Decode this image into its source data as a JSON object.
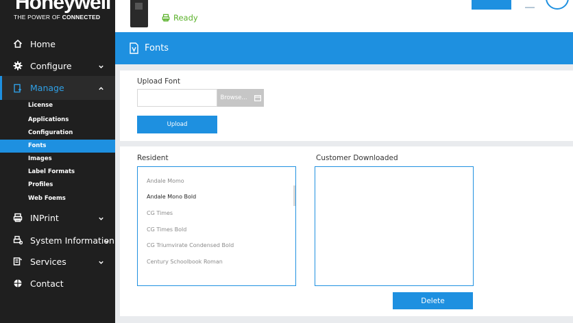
{
  "brand": {
    "name": "Honeywell",
    "tagline_prefix": "THE POWER OF ",
    "tagline_bold": "CONNECTED"
  },
  "header": {
    "status": "Ready",
    "status_color": "#5bb22b"
  },
  "sidebar": {
    "items": [
      {
        "label": "Home",
        "icon": "home-icon"
      },
      {
        "label": "Configure",
        "icon": "gear-icon"
      },
      {
        "label": "Manage",
        "icon": "document-icon"
      },
      {
        "label": "INPrint",
        "icon": "printer-icon"
      },
      {
        "label": "System Information",
        "icon": "printer-info-icon"
      },
      {
        "label": "Services",
        "icon": "services-icon"
      },
      {
        "label": "Contact",
        "icon": "globe-icon"
      }
    ],
    "manage_sub": [
      "License",
      "Applications",
      "Configuration",
      "Fonts",
      "Images",
      "Label Formats",
      "Profiles",
      "Web Foems"
    ],
    "active_sub": "Fonts"
  },
  "page": {
    "title": "Fonts"
  },
  "upload": {
    "label": "Upload Font",
    "file_value": "",
    "browse_label": "Browse...",
    "upload_label": "Upload"
  },
  "fonts": {
    "resident_label": "Resident",
    "customer_label": "Customer Downloaded",
    "resident_list": [
      "Andale Momo",
      "Andale Mono Bold",
      "CG Times",
      "CG Times Bold",
      "CG Triumvirate Condensed Bold",
      "Century Schoolbook Roman"
    ],
    "selected_resident": "Andale Mono Bold",
    "customer_list": [],
    "delete_label": "Delete"
  },
  "colors": {
    "accent": "#1e90e0",
    "sidebar_bg": "#1f1f1f"
  }
}
